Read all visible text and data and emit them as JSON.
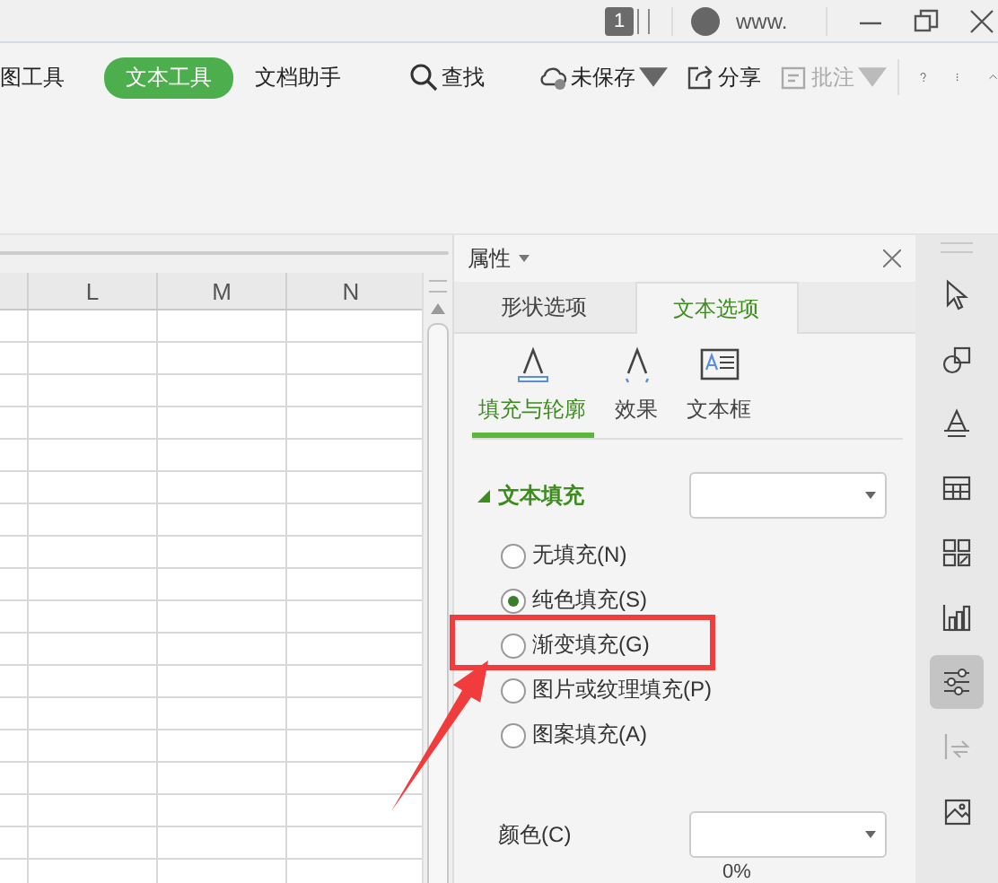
{
  "title_bar": {
    "page_badge": "1",
    "account": "www."
  },
  "ribbon_tabs": [
    {
      "label": "图工具",
      "selected": false
    },
    {
      "label": "文本工具",
      "selected": true
    },
    {
      "label": "文档助手",
      "selected": false
    }
  ],
  "toolbar": [
    {
      "kind": "search",
      "label": "查找",
      "disabled": false,
      "dropdown": false
    },
    {
      "kind": "cloud",
      "label": "未保存",
      "disabled": false,
      "dropdown": true
    },
    {
      "kind": "share",
      "label": "分享",
      "disabled": false,
      "dropdown": false
    },
    {
      "kind": "comment",
      "label": "批注",
      "disabled": true,
      "dropdown": true
    }
  ],
  "sheet": {
    "columns": [
      "L",
      "M",
      "N"
    ]
  },
  "panel": {
    "title": "属性",
    "tabs": [
      {
        "label": "形状选项",
        "selected": false
      },
      {
        "label": "文本选项",
        "selected": true
      }
    ],
    "subtabs": [
      {
        "kind": "fill",
        "label": "填充与轮廓",
        "selected": true
      },
      {
        "kind": "effect",
        "label": "效果",
        "selected": false
      },
      {
        "kind": "textbox",
        "label": "文本框",
        "selected": false
      }
    ],
    "section": {
      "title": "文本填充",
      "expanded": true
    },
    "fill_options": [
      {
        "label": "无填充(N)",
        "selected": false
      },
      {
        "label": "纯色填充(S)",
        "selected": true
      },
      {
        "label": "渐变填充(G)",
        "selected": false
      },
      {
        "label": "图片或纹理填充(P)",
        "selected": false
      },
      {
        "label": "图案填充(A)",
        "selected": false
      }
    ],
    "color_label": "颜色(C)",
    "transparency": "0%"
  },
  "sidebar_tools": [
    {
      "kind": "pointer",
      "selected": false,
      "disabled": false
    },
    {
      "kind": "shapes",
      "selected": false,
      "disabled": false
    },
    {
      "kind": "textstyle",
      "selected": false,
      "disabled": false
    },
    {
      "kind": "table",
      "selected": false,
      "disabled": false
    },
    {
      "kind": "widgets",
      "selected": false,
      "disabled": false
    },
    {
      "kind": "chart",
      "selected": false,
      "disabled": false
    },
    {
      "kind": "sliders",
      "selected": true,
      "disabled": false
    },
    {
      "kind": "convert",
      "selected": false,
      "disabled": true
    },
    {
      "kind": "picture",
      "selected": false,
      "disabled": false
    }
  ]
}
